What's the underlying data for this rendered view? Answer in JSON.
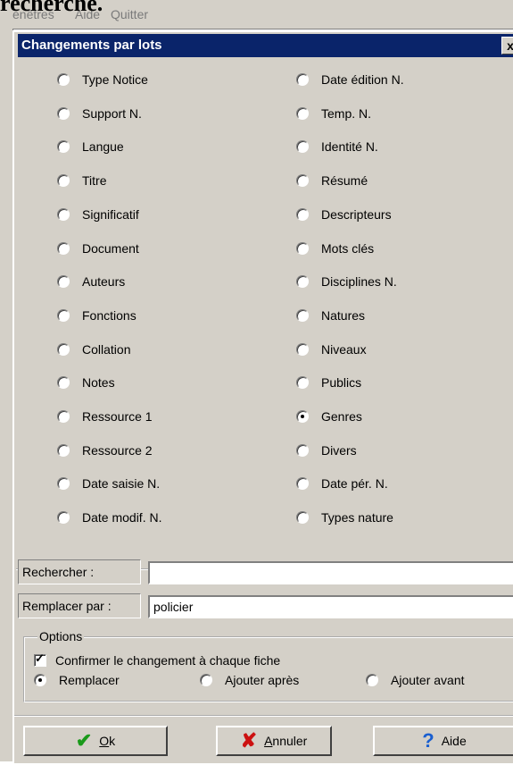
{
  "app_menu": {
    "items": [
      "enêtres",
      "Aide",
      "Quitter"
    ]
  },
  "top_text": "recherche.",
  "dialog": {
    "title": "Changements par lots",
    "close_label": "x",
    "left_fields": [
      "Type Notice",
      "Support N.",
      "Langue",
      "Titre",
      "Significatif",
      "Document",
      "Auteurs",
      "Fonctions",
      "Collation",
      "Notes",
      "Ressource 1",
      "Ressource 2",
      "Date saisie N.",
      "Date modif. N."
    ],
    "right_fields": [
      "Date édition N.",
      "Temp. N.",
      "Identité N.",
      "Résumé",
      "Descripteurs",
      "Mots clés",
      "Disciplines N.",
      "Natures",
      "Niveaux",
      "Publics",
      "Genres",
      "Divers",
      "Date pér. N.",
      "Types nature"
    ],
    "selected_field": "Genres",
    "search": {
      "label": "Rechercher :",
      "value": ""
    },
    "replace": {
      "label": "Remplacer par :",
      "value": "policier"
    },
    "options": {
      "legend": "Options",
      "confirm_label": "Confirmer le changement à chaque fiche",
      "confirm_checked": true,
      "modes": [
        "Remplacer",
        "Ajouter après",
        "Ajouter avant"
      ],
      "selected_mode": "Remplacer"
    },
    "buttons": {
      "ok": "Ok",
      "cancel": "Annuler",
      "help": "Aide"
    }
  },
  "colors": {
    "titlebar": "#0a246a",
    "face": "#d4d0c8",
    "ok_icon": "#1a9a1a",
    "cancel_icon": "#cc1111",
    "help_icon": "#1a5fd0"
  }
}
